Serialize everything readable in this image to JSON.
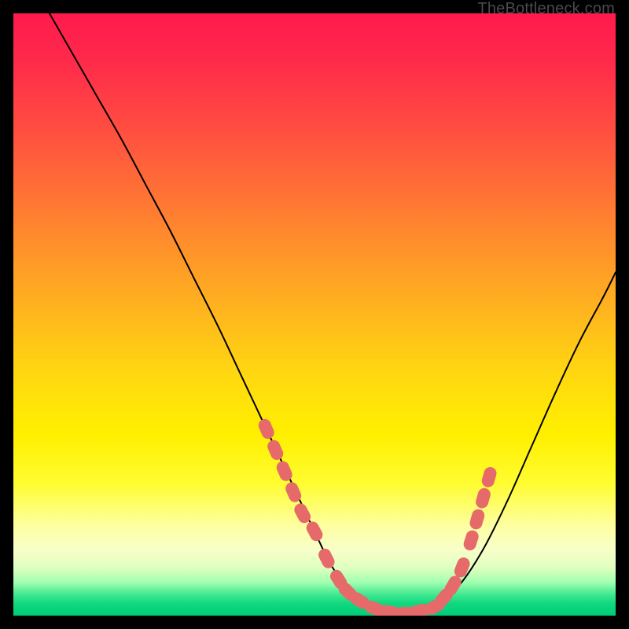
{
  "attribution": "TheBottleneck.com",
  "chart_data": {
    "type": "line",
    "title": "",
    "xlabel": "",
    "ylabel": "",
    "xlim": [
      0,
      100
    ],
    "ylim": [
      0,
      100
    ],
    "series": [
      {
        "name": "bottleneck-curve",
        "x": [
          6,
          10,
          14,
          18,
          22,
          26,
          30,
          34,
          38,
          42,
          46,
          50,
          53,
          56.5,
          60,
          63,
          66,
          70,
          74,
          78,
          82,
          86,
          90,
          94,
          98,
          100
        ],
        "y": [
          100,
          93,
          86,
          79,
          71.5,
          64,
          56,
          48,
          39.5,
          31,
          22.5,
          14,
          8,
          3.5,
          1.2,
          0.4,
          0.4,
          1.5,
          5,
          11,
          19,
          28,
          37,
          45.5,
          53,
          57
        ]
      }
    ],
    "markers": [
      {
        "name": "highlight-dots",
        "color": "#e66a6a",
        "points": [
          {
            "x": 42.0,
            "y": 31.0
          },
          {
            "x": 43.5,
            "y": 27.5
          },
          {
            "x": 45.0,
            "y": 24.0
          },
          {
            "x": 46.5,
            "y": 20.5
          },
          {
            "x": 48.0,
            "y": 17.0
          },
          {
            "x": 50.0,
            "y": 14.0
          },
          {
            "x": 52.0,
            "y": 9.5
          },
          {
            "x": 54.0,
            "y": 6.0
          },
          {
            "x": 55.5,
            "y": 4.0
          },
          {
            "x": 57.5,
            "y": 2.5
          },
          {
            "x": 60.0,
            "y": 1.2
          },
          {
            "x": 62.5,
            "y": 0.6
          },
          {
            "x": 65.0,
            "y": 0.4
          },
          {
            "x": 67.5,
            "y": 0.8
          },
          {
            "x": 70.0,
            "y": 1.5
          },
          {
            "x": 71.5,
            "y": 3.0
          },
          {
            "x": 73.0,
            "y": 5.0
          },
          {
            "x": 74.5,
            "y": 8.0
          },
          {
            "x": 76.0,
            "y": 12.5
          },
          {
            "x": 77.0,
            "y": 16.0
          },
          {
            "x": 78.0,
            "y": 19.5
          },
          {
            "x": 79.0,
            "y": 23.0
          }
        ]
      }
    ]
  }
}
